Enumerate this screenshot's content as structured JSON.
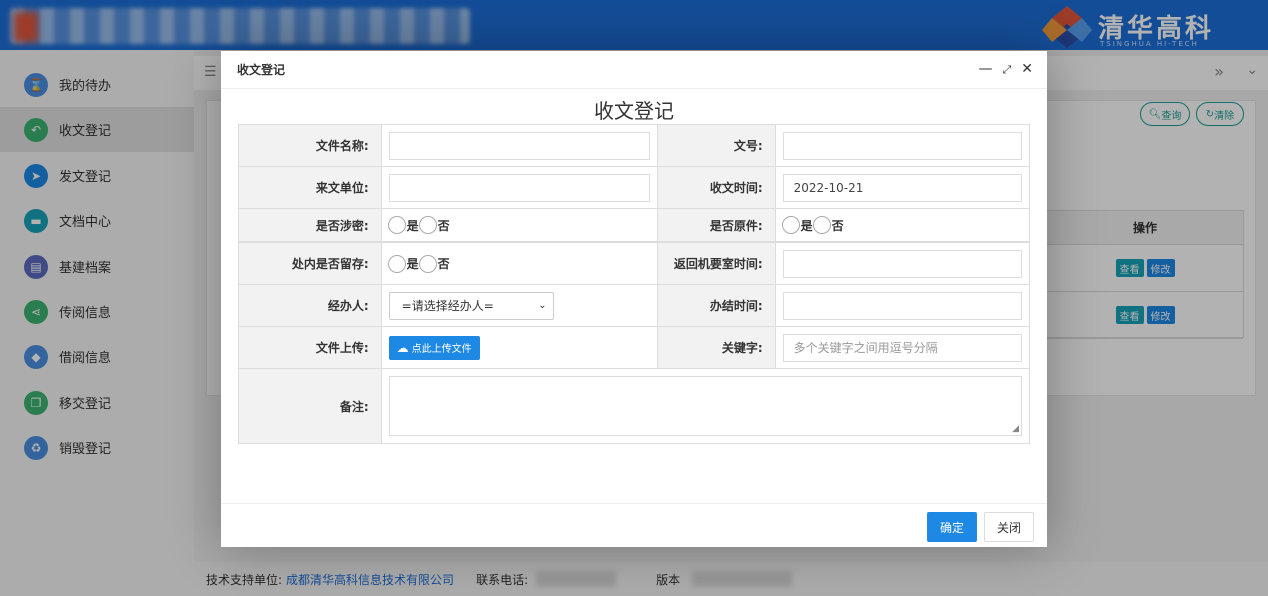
{
  "brand": {
    "name": "清华高科",
    "subtitle": "TSINGHUA HI-TECH"
  },
  "colors": {
    "header": "#1d6fd8",
    "primary": "#1e88e5",
    "teal": "#1aa094"
  },
  "sidebar": {
    "items": [
      {
        "label": "我的待办",
        "icon": "hourglass-icon",
        "color": "#4a90e2"
      },
      {
        "label": "收文登记",
        "icon": "reply-icon",
        "color": "#3cb371"
      },
      {
        "label": "发文登记",
        "icon": "send-icon",
        "color": "#1e88e5"
      },
      {
        "label": "文档中心",
        "icon": "folder-icon",
        "color": "#17a2b8"
      },
      {
        "label": "基建档案",
        "icon": "archive-icon",
        "color": "#5b6bc0"
      },
      {
        "label": "传阅信息",
        "icon": "share-icon",
        "color": "#3cb371"
      },
      {
        "label": "借阅信息",
        "icon": "tag-icon",
        "color": "#4a90e2"
      },
      {
        "label": "移交登记",
        "icon": "copy-icon",
        "color": "#3cb371"
      },
      {
        "label": "销毁登记",
        "icon": "recycle-icon",
        "color": "#4a90e2"
      }
    ]
  },
  "background": {
    "query_label": "查询",
    "clear_label": "清除",
    "table_header": "操作",
    "view_label": "查看",
    "edit_label": "修改"
  },
  "footer": {
    "support_label": "技术支持单位:",
    "support_company": "成都清华高科信息技术有限公司",
    "phone_label": "联系电话:",
    "version_label": "版本"
  },
  "dialog": {
    "title": "收文登记",
    "form_title": "收文登记",
    "fields": {
      "doc_name_label": "文件名称:",
      "doc_no_label": "文号:",
      "from_unit_label": "来文单位:",
      "recv_time_label": "收文时间:",
      "recv_time_value": "2022-10-21",
      "secret_label": "是否涉密:",
      "original_label": "是否原件:",
      "retain_label": "处内是否留存:",
      "return_time_label": "返回机要室时间:",
      "handler_label": "经办人:",
      "handler_value": "=请选择经办人=",
      "finish_time_label": "办结时间:",
      "upload_label": "文件上传:",
      "upload_button": "点此上传文件",
      "keyword_label": "关键字:",
      "keyword_placeholder": "多个关键字之间用逗号分隔",
      "remark_label": "备注:",
      "yes": "是",
      "no": "否"
    },
    "ok_label": "确定",
    "close_label": "关闭"
  }
}
